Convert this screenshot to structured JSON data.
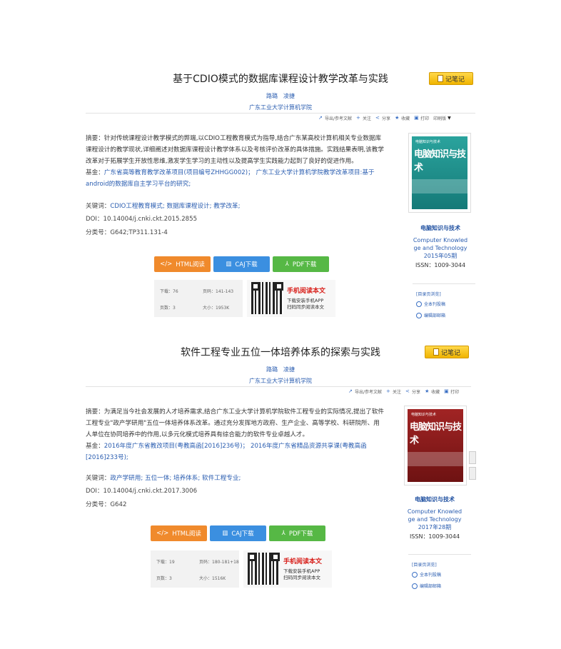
{
  "articles": [
    {
      "title": "基于CDIO模式的数据库课程设计教学改革与实践",
      "note_btn": "记笔记",
      "authors": [
        "路璐",
        "凌捷"
      ],
      "institution": "广东工业大学计算机学院",
      "toolbar": {
        "export": "导出/参考文献",
        "follow": "关注",
        "share": "分享",
        "favorite": "收藏",
        "print": "打印",
        "print_ver": "印刷版"
      },
      "abstract_label": "摘要：",
      "abstract": "针对传统课程设计教学模式的弊端,以CDIO工程教育模式为指导,结合广东某高校计算机相关专业数据库课程设计的教学现状,详细阐述对数据库课程设计教学体系以及考核评价改革的具体措施。实践结果表明,该教学改革对于拓展学生开放性思维,激发学生学习的主动性以及提高学生实践能力起到了良好的促进作用。",
      "fund_label": "基金：",
      "fund": "广东省高等教育教学改革项目(项目编号ZHHGG002)； 广东工业大学计算机学院教学改革项目:基于android的数据库自主学习平台的研究;",
      "keywords_label": "关键词：",
      "keywords": "CDIO工程教育模式; 数据库课程设计; 教学改革;",
      "doi_label": "DOI：",
      "doi": "10.14004/j.cnki.ckt.2015.2855",
      "class_label": "分类号：",
      "class_no": "G642;TP311.131-4",
      "journal": {
        "cover_small": "电脑知识与技术",
        "cover_big": "电脑知识与技术",
        "name": "电脑知识与技术",
        "en1": "Computer Knowled",
        "en2": "ge and Technology",
        "issue": "2015年05期",
        "issn": "ISSN：1009-3044"
      },
      "sidelinks": {
        "head": "[目录页浏览]",
        "l1": "全本刊投稿",
        "l2": "编辑部邮箱"
      },
      "buttons": {
        "html": "HTML阅读",
        "caj": "CAJ下载",
        "pdf": "PDF下载"
      },
      "stats": {
        "downloads_label": "下载：",
        "downloads": "76",
        "pages_label": "页码：",
        "pages": "141-143",
        "pagecount_label": "页数：",
        "pagecount": "3",
        "size_label": "大小：",
        "size": "1953K"
      },
      "mobile": {
        "title": "手机阅读本文",
        "line1": "下载安装手机APP",
        "line2": "扫码同步阅读本文"
      }
    },
    {
      "title": "软件工程专业五位一体培养体系的探索与实践",
      "note_btn": "记笔记",
      "authors": [
        "路璐",
        "凌捷"
      ],
      "institution": "广东工业大学计算机学院",
      "toolbar": {
        "export": "导出/参考文献",
        "follow": "关注",
        "share": "分享",
        "favorite": "收藏",
        "print": "打印"
      },
      "abstract_label": "摘要：",
      "abstract": "为满足当今社会发展的人才培养需求,结合广东工业大学计算机学院软件工程专业的实际情况,提出了软件工程专业\"政产学研用\"五位一体培养体系改革。通过充分发挥地方政府、生产企业、高等学校、科研院所、用人单位在协同培养中的作用,以多元化模式培养具有综合能力的软件专业卓越人才。",
      "fund_label": "基金：",
      "fund": "2016年度广东省教改项目(粤教高函[2016]236号)； 2016年度广东省精品资源共享课(粤教高函[2016]233号);",
      "keywords_label": "关键词：",
      "keywords": "政产学研用; 五位一体; 培养体系; 软件工程专业;",
      "doi_label": "DOI：",
      "doi": "10.14004/j.cnki.ckt.2017.3006",
      "class_label": "分类号：",
      "class_no": "G642",
      "journal": {
        "cover_small": "电脑知识与技术",
        "cover_big": "电脑知识与技术",
        "name": "电脑知识与技术",
        "en1": "Computer Knowled",
        "en2": "ge and Technology",
        "issue": "2017年28期",
        "issn": "ISSN：1009-3044"
      },
      "sidelinks": {
        "head": "[目录页浏览]",
        "l1": "全本刊投稿",
        "l2": "编辑部邮箱"
      },
      "buttons": {
        "html": "HTML阅读",
        "caj": "CAJ下载",
        "pdf": "PDF下载"
      },
      "stats": {
        "downloads_label": "下载：",
        "downloads": "19",
        "pages_label": "页码：",
        "pages": "180-181+18",
        "pagecount_label": "页数：",
        "pagecount": "3",
        "size_label": "大小：",
        "size": "1516K"
      },
      "mobile": {
        "title": "手机阅读本文",
        "line1": "下载安装手机APP",
        "line2": "扫码同步阅读本文"
      }
    }
  ],
  "colors": {
    "link": "#2a5db0",
    "html_btn": "#f08a2c",
    "caj_btn": "#3b8fe0",
    "pdf_btn": "#56b845",
    "note_btn": "#f5c518",
    "mobile_red": "#d8211c",
    "cover1": "#1f8f8a",
    "cover2": "#8b1a1a"
  }
}
